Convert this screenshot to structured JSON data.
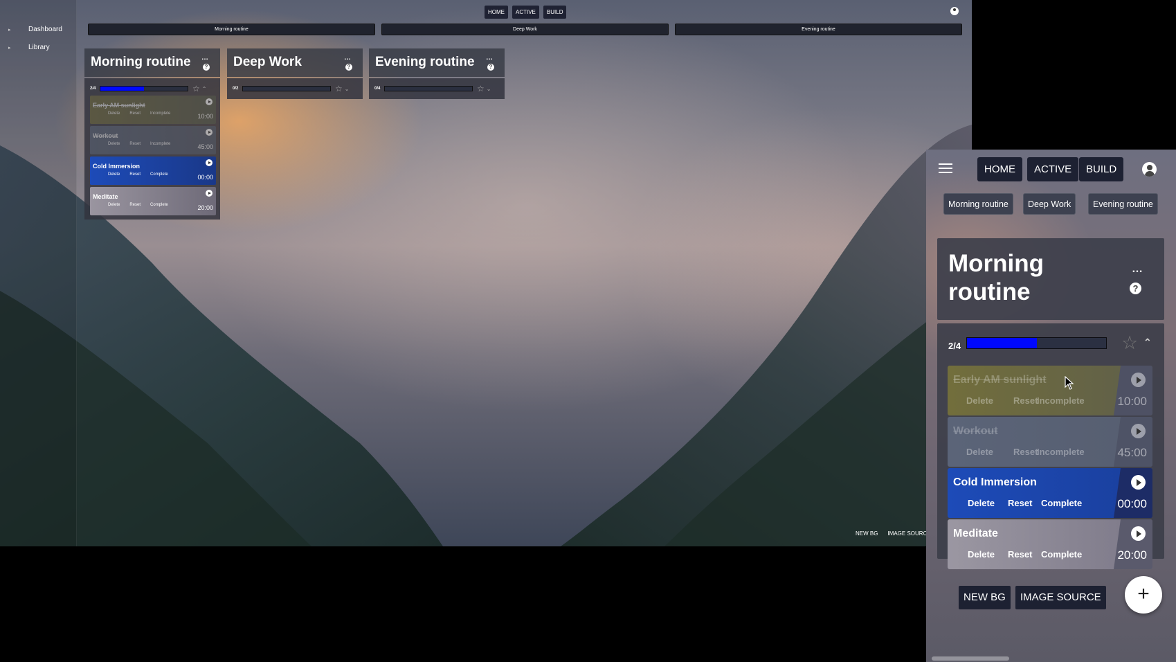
{
  "sidebar": {
    "items": [
      {
        "label": "Dashboard"
      },
      {
        "label": "Library"
      }
    ]
  },
  "nav": {
    "home": "HOME",
    "active": "ACTIVE",
    "build": "BUILD"
  },
  "tabs": [
    "Morning routine",
    "Deep Work",
    "Evening routine"
  ],
  "columns": [
    {
      "title": "Morning routine",
      "progress_label": "2/4",
      "progress_fraction": 0.5,
      "tasks": [
        {
          "name": "Early AM sunlight",
          "actions": [
            "Delete",
            "Reset",
            "Incomplete"
          ],
          "time": "10:00",
          "done": true
        },
        {
          "name": "Workout",
          "actions": [
            "Delete",
            "Reset",
            "Incomplete"
          ],
          "time": "45:00",
          "done": true
        },
        {
          "name": "Cold Immersion",
          "actions": [
            "Delete",
            "Reset",
            "Complete"
          ],
          "time": "00:00",
          "done": false
        },
        {
          "name": "Meditate",
          "actions": [
            "Delete",
            "Reset",
            "Complete"
          ],
          "time": "20:00",
          "done": false
        }
      ]
    },
    {
      "title": "Deep Work",
      "progress_label": "0/2",
      "progress_fraction": 0
    },
    {
      "title": "Evening routine",
      "progress_label": "0/4",
      "progress_fraction": 0
    }
  ],
  "menu_dots": "…",
  "help_icon": "?",
  "footer": {
    "new_bg": "NEW BG",
    "image_source_desktop": "IMAGE SOURC",
    "image_source": "IMAGE SOURCE"
  },
  "fab_label": "+",
  "colors": {
    "progress_fill": "#0008ff",
    "nav_button": "#1d2132",
    "cold_immersion": "#1c48b4",
    "early_am": "#6e6a3c",
    "workout": "#5a6478",
    "meditate": "#8a8796"
  },
  "icons": [
    "hamburger-menu-icon",
    "user-account-icon",
    "help-icon",
    "more-dots-icon",
    "star-icon",
    "chevron-up-icon",
    "play-icon",
    "plus-icon"
  ]
}
